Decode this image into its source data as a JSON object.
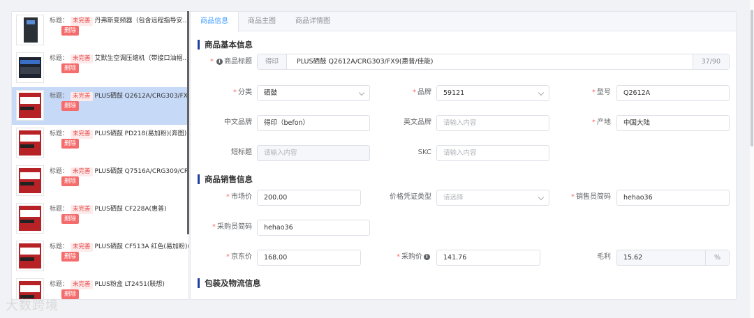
{
  "product_list": {
    "title_label": "标题：",
    "status_tag": "未完善",
    "delete_label": "删除",
    "items": [
      {
        "title": "丹弗斯变频器（包含远程指导安..."
      },
      {
        "title": "艾默生空调压缩机（带接口油帽..."
      },
      {
        "title": "PLUS硒鼓 Q2612A/CRG303/FX..."
      },
      {
        "title": "PLUS硒鼓 PD218(易加粉)(奔图)"
      },
      {
        "title": "PLUS硒鼓 Q7516A/CRG309/CR..."
      },
      {
        "title": "PLUS硒鼓 CF228A(惠普)"
      },
      {
        "title": "PLUS硒鼓 CF513A 红色(易加粉)(..."
      },
      {
        "title": "PLUS粉盒 LT2451(联想)"
      }
    ]
  },
  "tabs": [
    "商品信息",
    "商品主图",
    "商品详情图"
  ],
  "basic_section": "商品基本信息",
  "sales_section": "商品销售信息",
  "logistics_section": "包装及物流信息",
  "form": {
    "product_title_label": "商品标题",
    "product_title_prefix": "得印",
    "product_title_value": "PLUS硒鼓 Q2612A/CRG303/FX9(惠普/佳能)",
    "product_title_count": "37/90",
    "category_label": "分类",
    "category_value": "硒鼓",
    "brand_label": "品牌",
    "brand_value": "59121",
    "model_label": "型号",
    "model_value": "Q2612A",
    "cn_brand_label": "中文品牌",
    "cn_brand_value": "得印（befon）",
    "en_brand_label": "英文品牌",
    "en_brand_placeholder": "请输入内容",
    "origin_label": "产地",
    "origin_value": "中国大陆",
    "short_title_label": "短标题",
    "short_title_placeholder": "请输入内容",
    "skc_label": "SKC",
    "skc_placeholder": "请输入内容",
    "market_price_label": "市场价",
    "market_price_value": "200.00",
    "price_doc_label": "价格凭证类型",
    "price_doc_placeholder": "请选择",
    "seller_code_label": "销售员简码",
    "seller_code_value": "hehao36",
    "buyer_code_label": "采购员简码",
    "buyer_code_value": "hehao36",
    "jd_price_label": "京东价",
    "jd_price_value": "168.00",
    "purchase_price_label": "采购价",
    "purchase_price_value": "141.76",
    "margin_label": "毛利",
    "margin_value": "15.62",
    "margin_unit": "%"
  },
  "watermark": "大数跨境",
  "colors": {
    "accent": "#409eff",
    "danger": "#f56c6c",
    "section_bar": "#1f3fa5",
    "active_item": "#c6d9f7"
  }
}
